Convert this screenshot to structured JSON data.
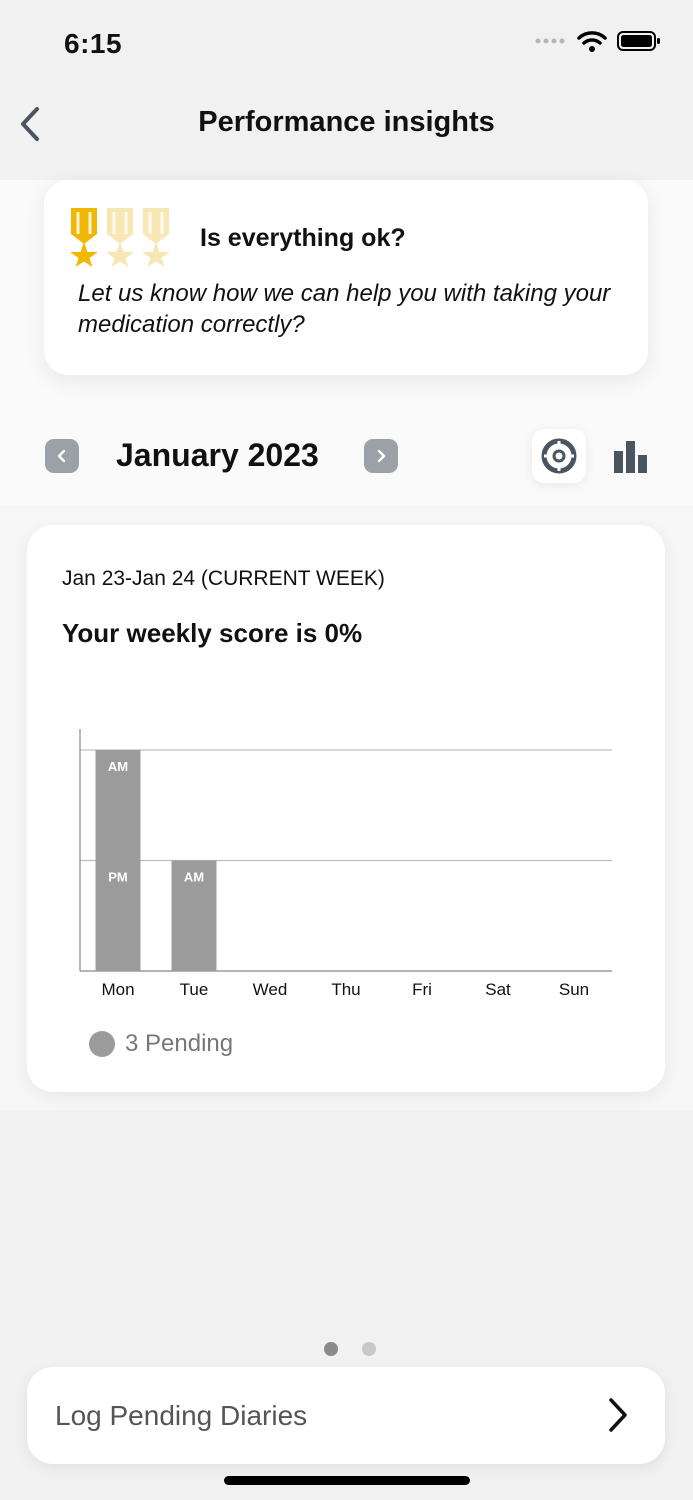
{
  "status_bar": {
    "time": "6:15",
    "icons": [
      "signal-dots-icon",
      "wifi-icon",
      "battery-icon"
    ]
  },
  "nav": {
    "title": "Performance insights",
    "back_icon": "chevron-left-icon"
  },
  "help_card": {
    "title": "Is everything ok?",
    "body": "Let us know how we can help you with taking your medication correctly?",
    "medals": {
      "earned": 1,
      "total": 3
    }
  },
  "month_selector": {
    "label": "January 2023",
    "prev_icon": "chevron-left-icon",
    "next_icon": "chevron-right-icon",
    "views": [
      "donut-chart-icon",
      "bar-chart-icon"
    ],
    "active_view": "donut-chart-icon"
  },
  "week_card": {
    "range": "Jan 23-Jan 24 (CURRENT WEEK)",
    "score_text": "Your weekly score is 0%",
    "legend_label": "3 Pending"
  },
  "chart_data": {
    "type": "bar",
    "categories": [
      "Mon",
      "Tue",
      "Wed",
      "Thu",
      "Fri",
      "Sat",
      "Sun"
    ],
    "stacks": [
      {
        "day": "Mon",
        "segments": [
          "PM",
          "AM"
        ]
      },
      {
        "day": "Tue",
        "segments": [
          "AM"
        ]
      },
      {
        "day": "Wed",
        "segments": []
      },
      {
        "day": "Thu",
        "segments": []
      },
      {
        "day": "Fri",
        "segments": []
      },
      {
        "day": "Sat",
        "segments": []
      },
      {
        "day": "Sun",
        "segments": []
      }
    ],
    "max_doses": 2,
    "bar_color": "#9b9b9b",
    "grid": true
  },
  "pager": {
    "pages": 2,
    "current": 1
  },
  "log_button": {
    "label": "Log Pending Diaries",
    "icon": "chevron-right-icon"
  },
  "colors": {
    "medal_gold": "#f2b705",
    "medal_faded": "#f7e7b4",
    "pending_gray": "#9b9b9b",
    "nav_button_gray": "#9ba1a6"
  }
}
